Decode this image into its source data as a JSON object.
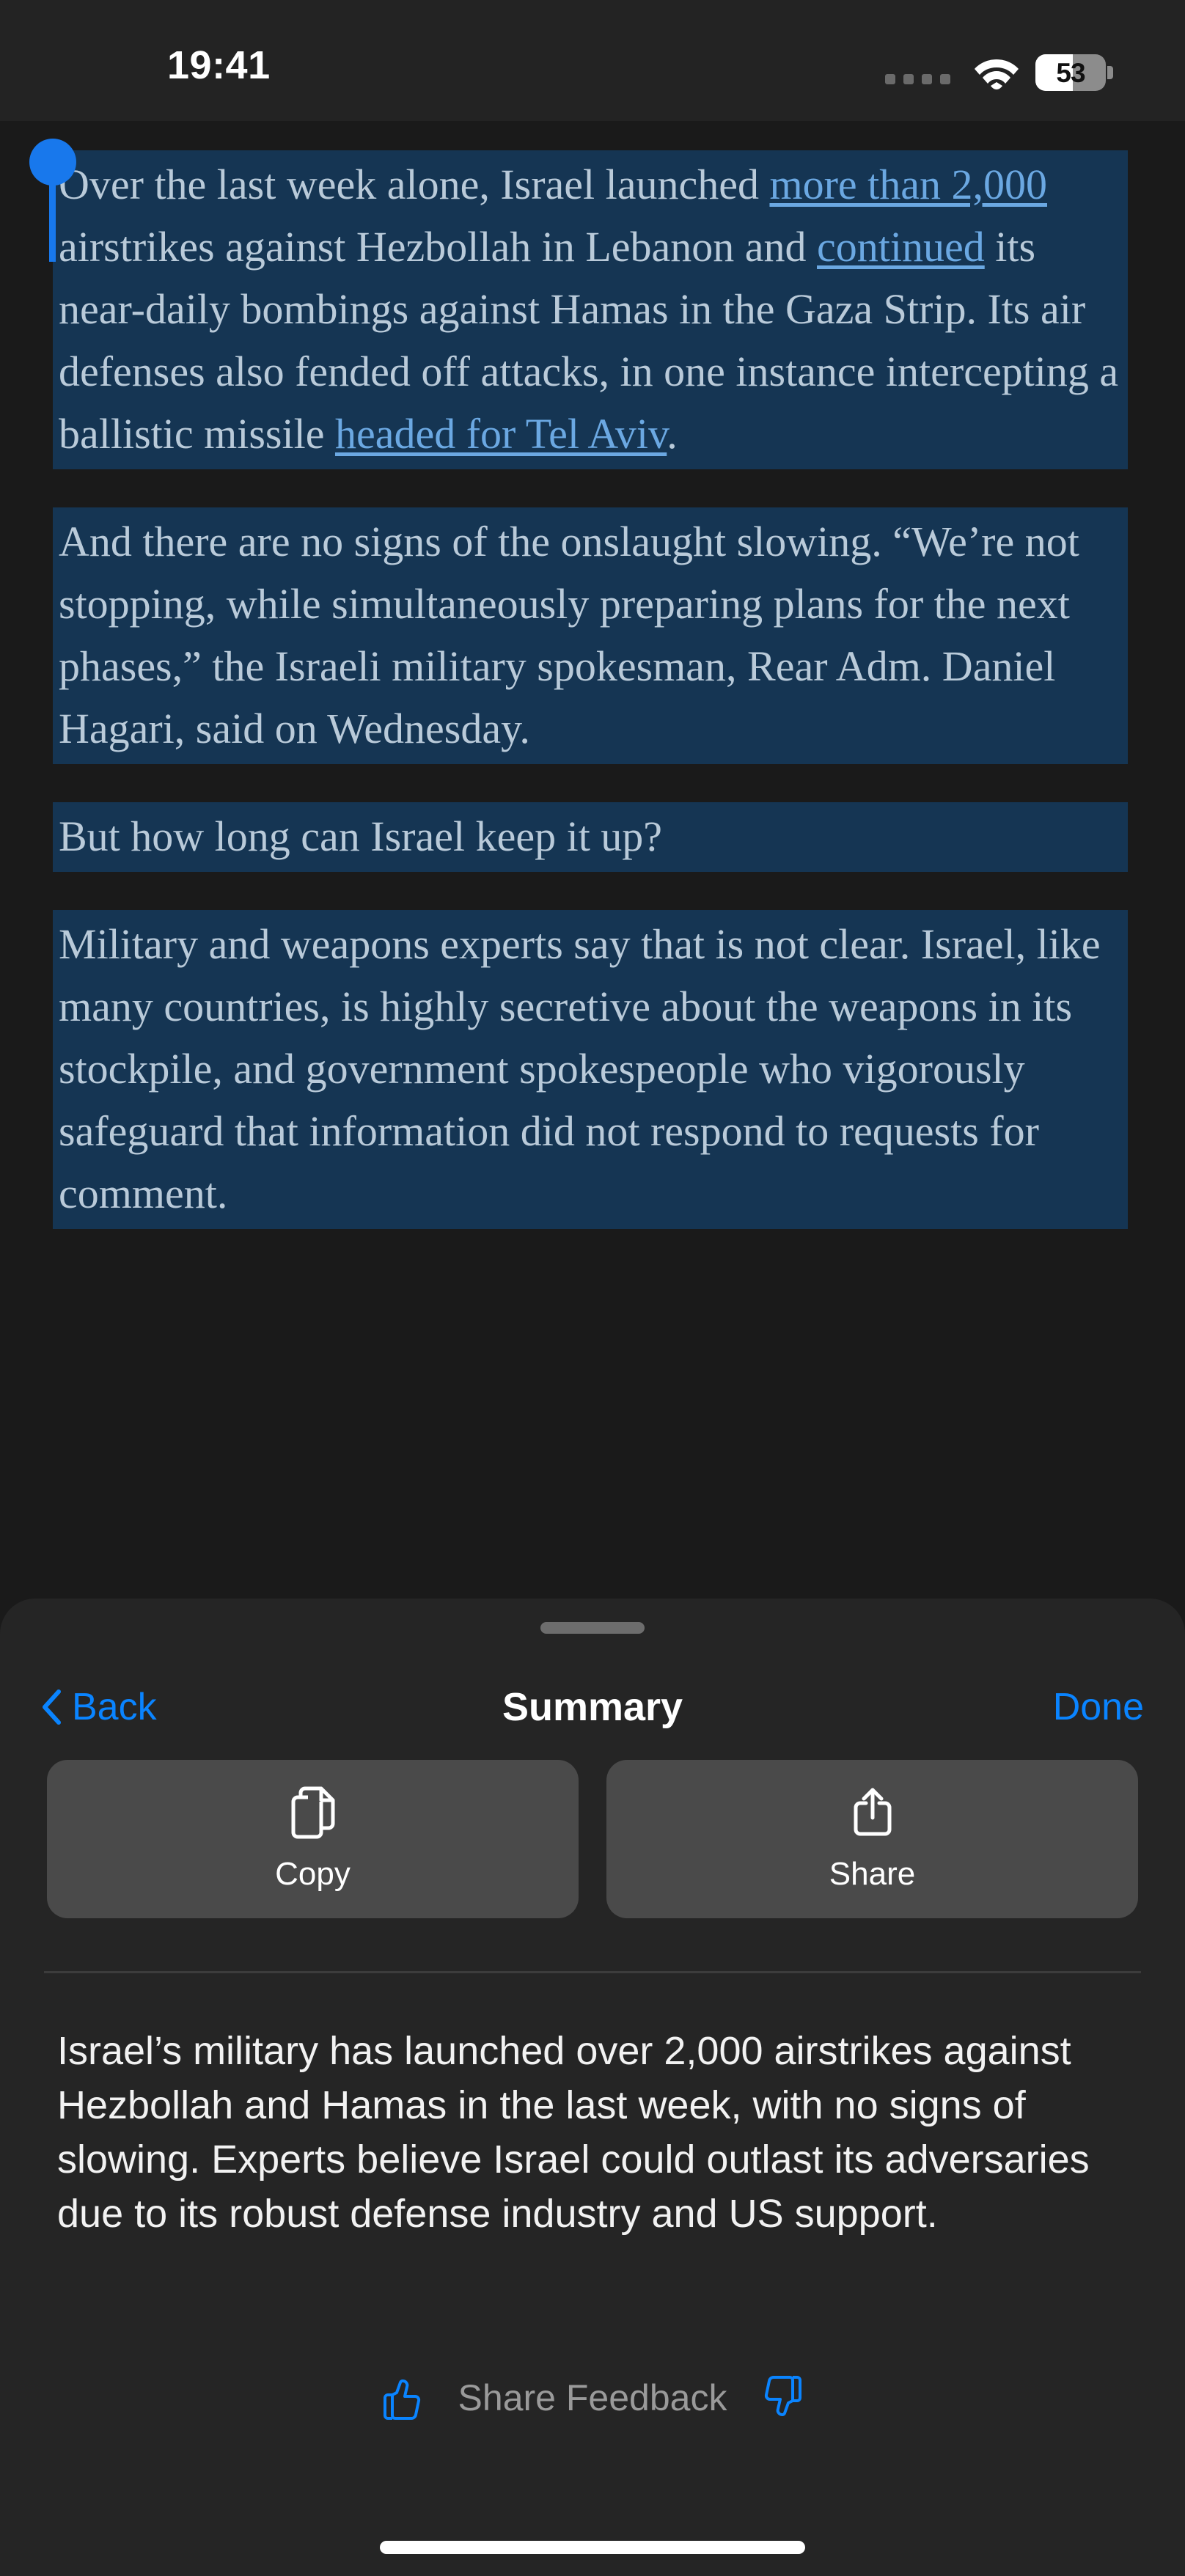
{
  "status_bar": {
    "time": "19:41",
    "battery_percent": "53",
    "battery_level": 53,
    "wifi_icon": "wifi-icon",
    "signal_icon": "cellular-dots-icon"
  },
  "article": {
    "selection_color": "#153553",
    "text_color": "#b9cad9",
    "link_color": "#6ba8e2",
    "paragraphs": [
      {
        "runs": [
          {
            "type": "text",
            "text": "Over the last week alone, Israel launched "
          },
          {
            "type": "link",
            "text": "more than 2,000"
          },
          {
            "type": "text",
            "text": " airstrikes against Hezbollah in Lebanon and "
          },
          {
            "type": "link",
            "text": "continued"
          },
          {
            "type": "text",
            "text": " its near-daily bombings against Hamas in the Gaza Strip. Its air defenses also fended off attacks, in one instance intercepting a ballistic missile "
          },
          {
            "type": "link",
            "text": "headed for Tel Aviv"
          },
          {
            "type": "text",
            "text": "."
          }
        ]
      },
      {
        "runs": [
          {
            "type": "text",
            "text": "And there are no signs of the onslaught slowing. “We’re not stopping, while simultaneously preparing plans for the next phases,” the Israeli military spokesman, Rear Adm. Daniel Hagari, said on Wednesday."
          }
        ]
      },
      {
        "runs": [
          {
            "type": "text",
            "text": "But how long can Israel keep it up?"
          }
        ]
      },
      {
        "runs": [
          {
            "type": "text",
            "text": "Military and weapons experts say that is not clear. Israel, like many countries, is highly secretive about the weapons in its stockpile, and government spokespeople who vigorously safeguard that information did not respond to requests for comment."
          }
        ]
      }
    ]
  },
  "sheet": {
    "grabber": "sheet-grabber",
    "nav": {
      "back_label": "Back",
      "back_icon": "chevron-left-icon",
      "title": "Summary",
      "done_label": "Done"
    },
    "actions": [
      {
        "label": "Copy",
        "icon": "copy-doc-icon"
      },
      {
        "label": "Share",
        "icon": "share-square-arrow-up-icon"
      }
    ],
    "summary": "Israel’s military has launched over 2,000 airstrikes against Hezbollah and Hamas in the last week, with no signs of slowing. Experts believe Israel could outlast its adversaries due to its robust defense industry and US support.",
    "feedback": {
      "label": "Share Feedback",
      "thumbs_up_icon": "thumbs-up-icon",
      "thumbs_down_icon": "thumbs-down-icon",
      "accent_color": "#0a84ff"
    }
  }
}
